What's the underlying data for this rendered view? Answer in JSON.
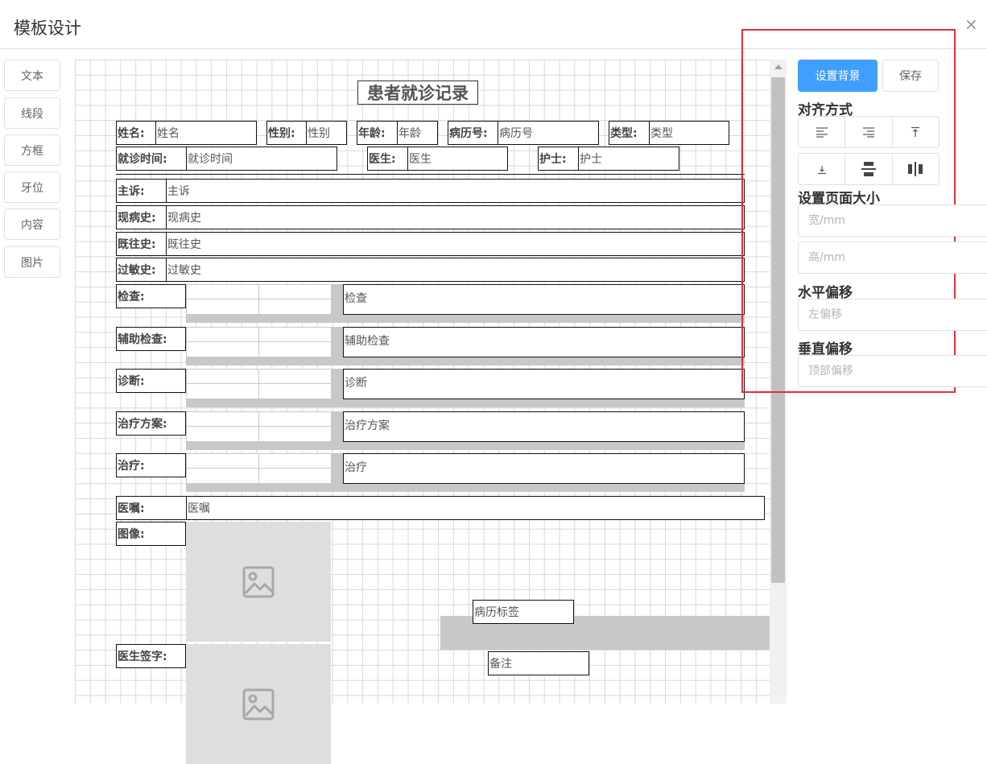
{
  "dialog": {
    "title": "模板设计",
    "close": "×"
  },
  "toolbox": [
    "文本",
    "线段",
    "方框",
    "牙位",
    "内容",
    "图片"
  ],
  "template": {
    "title": "患者就诊记录",
    "row1": [
      {
        "label": "姓名:",
        "value": "姓名"
      },
      {
        "label": "性别:",
        "value": "性别"
      },
      {
        "label": "年龄:",
        "value": "年龄"
      },
      {
        "label": "病历号:",
        "value": "病历号"
      },
      {
        "label": "类型:",
        "value": "类型"
      }
    ],
    "row2": [
      {
        "label": "就诊时间:",
        "value": "就诊时间"
      },
      {
        "label": "医生:",
        "value": "医生"
      },
      {
        "label": "护士:",
        "value": "护士"
      }
    ],
    "history": [
      {
        "label": "主诉:",
        "value": "主诉"
      },
      {
        "label": "现病史:",
        "value": "现病史"
      },
      {
        "label": "既往史:",
        "value": "既往史"
      },
      {
        "label": "过敏史:",
        "value": "过敏史"
      }
    ],
    "sections": [
      {
        "label": "检查:",
        "value": "检查"
      },
      {
        "label": "辅助检查:",
        "value": "辅助检查"
      },
      {
        "label": "诊断:",
        "value": "诊断"
      },
      {
        "label": "治疗方案:",
        "value": "治疗方案"
      },
      {
        "label": "治疗:",
        "value": "治疗"
      }
    ],
    "advice": {
      "label": "医嘱:",
      "value": "医嘱"
    },
    "image_label": "图像:",
    "signature_label": "医生签字:",
    "record_tag": "病历标签",
    "remark": "备注"
  },
  "panel": {
    "set_background": "设置背景",
    "save": "保存",
    "align_title": "对齐方式",
    "align_buttons": [
      "align-left-icon",
      "align-right-icon",
      "align-top-icon",
      "align-bottom-icon",
      "align-vertical-center-icon",
      "align-horizontal-center-icon"
    ],
    "page_size_title": "设置页面大小",
    "width_placeholder": "宽/mm",
    "height_placeholder": "高/mm",
    "h_offset_title": "水平偏移",
    "left_offset_placeholder": "左偏移",
    "v_offset_title": "垂直偏移",
    "top_offset_placeholder": "顶部偏移"
  },
  "colors": {
    "primary": "#409eff",
    "highlight_border": "#e03038",
    "grid": "#d8d8d8",
    "placeholder_gray": "#dedede"
  }
}
